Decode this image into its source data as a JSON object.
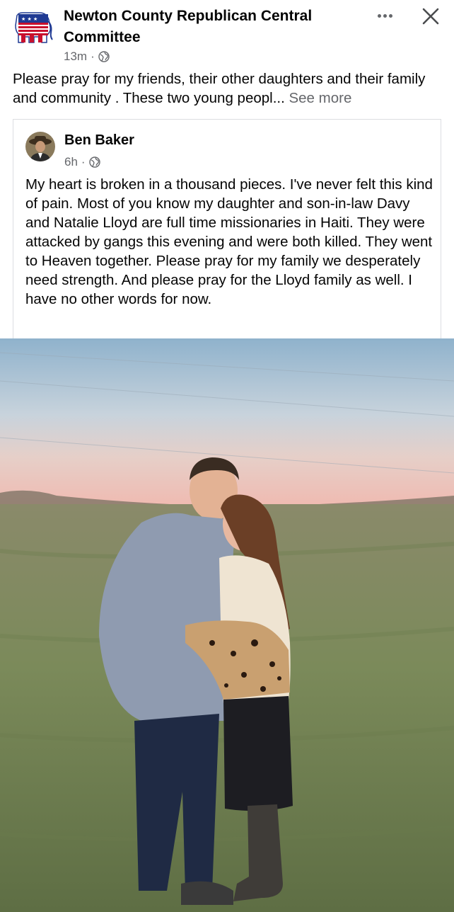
{
  "post": {
    "page_name": "Newton County Republican Central Committee",
    "time": "13m",
    "meta_separator": "·",
    "audience_icon": "globe-icon",
    "text": "Please pray for my friends, their other daughters and their family and community . These two young peopl... ",
    "see_more_label": "See more",
    "actions": {
      "more_icon": "more-horizontal-icon",
      "close_icon": "close-icon"
    }
  },
  "shared": {
    "author": "Ben Baker",
    "time": "6h",
    "meta_separator": "·",
    "audience_icon": "globe-icon",
    "text": "My heart is broken in a thousand pieces. I've never felt this kind of pain. Most of you know my daughter and son-in-law Davy and Natalie Lloyd are full time missionaries in Haiti. They were attacked by gangs this evening and were both killed. They went to Heaven together. Please pray for my family we desperately need strength. And please pray for the Lloyd family as well. I have no other words for now."
  },
  "colors": {
    "text": "#050505",
    "secondary": "#65676b",
    "border": "#dcdde1",
    "gop_red": "#c8102e",
    "gop_blue": "#1f3a93"
  }
}
